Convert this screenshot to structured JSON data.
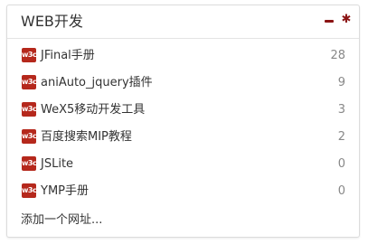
{
  "panel": {
    "title": "WEB开发",
    "minimize_icon": "minus-icon",
    "settings_icon": "gear-icon",
    "settings_glyph": "✱",
    "accent_color": "#8b1414"
  },
  "items": [
    {
      "icon_text": "w3c",
      "label": "JFinal手册",
      "count": "28"
    },
    {
      "icon_text": "w3c",
      "label": "aniAuto_jquery插件",
      "count": "9"
    },
    {
      "icon_text": "w3c",
      "label": "WeX5移动开发工具",
      "count": "3"
    },
    {
      "icon_text": "w3c",
      "label": "百度搜索MIP教程",
      "count": "2"
    },
    {
      "icon_text": "w3c",
      "label": "JSLite",
      "count": "0"
    },
    {
      "icon_text": "w3c",
      "label": "YMP手册",
      "count": "0"
    }
  ],
  "footer": {
    "add_link": "添加一个网址..."
  }
}
